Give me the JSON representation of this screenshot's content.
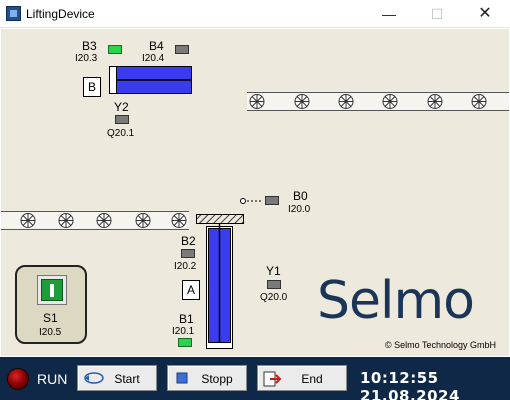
{
  "window": {
    "title": "LiftingDevice",
    "minimize_glyph": "—",
    "maximize_glyph": "☐",
    "close_glyph": "✕"
  },
  "sensors": {
    "b3": {
      "label": "B3",
      "address": "I20.3",
      "state": "on"
    },
    "b4": {
      "label": "B4",
      "address": "I20.4",
      "state": "off"
    },
    "y2": {
      "label": "Y2",
      "address": "Q20.1",
      "state": "off"
    },
    "b0": {
      "label": "B0",
      "address": "I20.0",
      "state": "off"
    },
    "b2": {
      "label": "B2",
      "address": "I20.2",
      "state": "off"
    },
    "y1": {
      "label": "Y1",
      "address": "Q20.0",
      "state": "off"
    },
    "b1": {
      "label": "B1",
      "address": "I20.1",
      "state": "on"
    }
  },
  "cylinder_labels": {
    "top": "B",
    "bottom": "A"
  },
  "switch_s1": {
    "label": "S1",
    "address": "I20.5"
  },
  "brand": {
    "name": "Selmo",
    "copyright": "© Selmo Technology GmbH"
  },
  "statusbar": {
    "run_label": "RUN",
    "start_label": "Start",
    "stop_label": "Stopp",
    "end_label": "End",
    "time": "10:12:55",
    "date": "21.08.2024"
  },
  "colors": {
    "cylinder_blue": "#3b3bf0",
    "sensor_on": "#2bd34a",
    "sensor_off": "#7a7a7a",
    "bottom_bar": "#0f2847",
    "brand": "#1b3558",
    "background": "#ede9dc"
  }
}
